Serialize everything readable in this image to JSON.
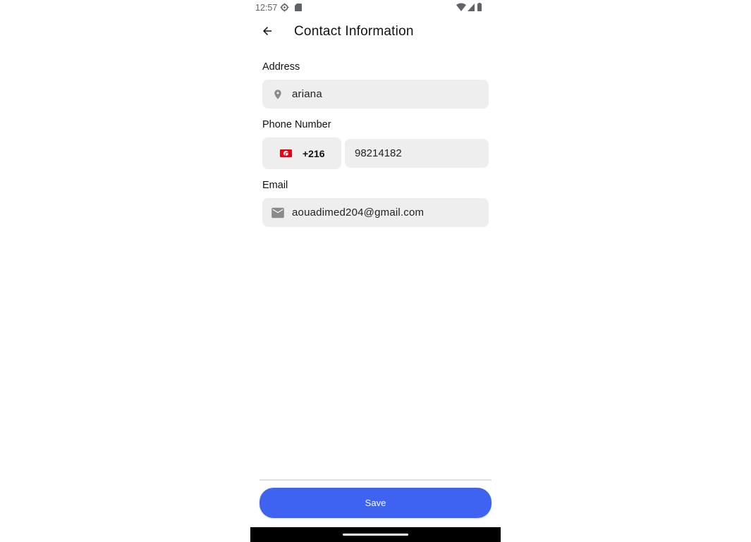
{
  "status_bar": {
    "time": "12:57"
  },
  "header": {
    "title": "Contact Information"
  },
  "form": {
    "address": {
      "label": "Address",
      "value": "ariana",
      "icon": "location-pin-icon"
    },
    "phone": {
      "label": "Phone Number",
      "country_flag": "tunisia-flag-icon",
      "dial_code": "+216",
      "value": "98214182"
    },
    "email": {
      "label": "Email",
      "value": "aouadimed204@gmail.com",
      "icon": "mail-icon"
    }
  },
  "footer": {
    "save_label": "Save"
  },
  "colors": {
    "accent": "#3d63f0",
    "field_bg": "#eeeeee",
    "flag_red": "#e70013"
  }
}
